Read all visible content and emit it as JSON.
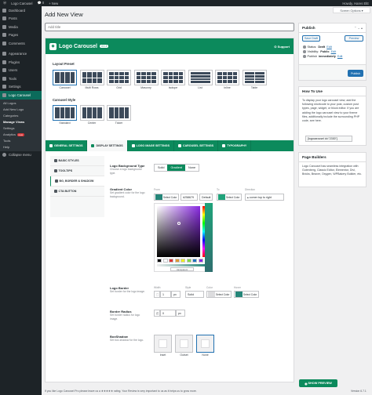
{
  "topbar": {
    "wp_logo": "wordpress-icon",
    "site_name": "Logo Carousel",
    "comments": "0",
    "new_label": "+ New",
    "howdy": "Howdy, Hares ElE"
  },
  "sidebar": {
    "items": [
      {
        "label": "Dashboard",
        "icon": "dashboard-icon"
      },
      {
        "label": "Posts",
        "icon": "pin-icon"
      },
      {
        "label": "Media",
        "icon": "media-icon"
      },
      {
        "label": "Pages",
        "icon": "page-icon"
      },
      {
        "label": "Comments",
        "icon": "comment-icon"
      },
      {
        "label": "Appearance",
        "icon": "brush-icon"
      },
      {
        "label": "Plugins",
        "icon": "plugin-icon"
      },
      {
        "label": "Users",
        "icon": "user-icon"
      },
      {
        "label": "Tools",
        "icon": "wrench-icon"
      },
      {
        "label": "Settings",
        "icon": "settings-icon"
      },
      {
        "label": "Logo Carousel",
        "icon": "carousel-icon"
      }
    ],
    "submenu": [
      "All Logos",
      "Add New Logo",
      "Categories",
      "Manage Views",
      "Settings",
      "Analytics",
      "Tools",
      "Help"
    ],
    "analytics_badge": "new",
    "collapse": "Collapse menu"
  },
  "screen_options": "Screen Options ▾",
  "heading": "Add New View",
  "title_placeholder": "Add title",
  "brand": {
    "name": "Logo Carousel",
    "version": "4.1.3",
    "support": "Support",
    "color": "#0c8a5c"
  },
  "layout_preset": {
    "label": "Layout Preset",
    "options": [
      "Carousel",
      "Multi Rows",
      "Grid",
      "Masonry",
      "Isotope",
      "List",
      "Inline",
      "Table"
    ],
    "selected": "Carousel"
  },
  "carousel_style": {
    "label": "Carousel Style",
    "options": [
      "Standard",
      "Center",
      "Ticker"
    ],
    "selected": "Standard"
  },
  "tabs": [
    "GENERAL SETTINGS",
    "DISPLAY SETTINGS",
    "LOGO IMAGE SETTINGS",
    "CAROUSEL SETTINGS",
    "TYPOGRAPHY"
  ],
  "active_tab": "DISPLAY SETTINGS",
  "subtabs": [
    "BASIC STYLES",
    "TOOLTIPS",
    "BG, BORDER & SHADOW",
    "CTA BUTTON"
  ],
  "active_subtab": "BG, BORDER & SHADOW",
  "bg_type": {
    "label": "Logo Background Type",
    "desc": "Choose a logo background type.",
    "options": [
      "Solid",
      "Gradient",
      "None"
    ],
    "selected": "Gradient"
  },
  "gradient": {
    "label": "Gradient Color",
    "desc": "Set gradient color for the logo background.",
    "from_label": "From",
    "to_label": "To",
    "direction_label": "Direction",
    "select_color": "Select Color",
    "from_hex": "#258679",
    "default_btn": "Default",
    "from_color": "#258679",
    "to_color": "#1fa37a",
    "direction": "▴ corner top to right",
    "picker_value": "transparent",
    "palette": [
      "#000000",
      "#ffffff",
      "#dd3333",
      "#dd9933",
      "#eeee22",
      "#81d742",
      "#1e73be",
      "#8224e3"
    ]
  },
  "border": {
    "label": "Logo Border",
    "desc": "Set border for the logo image.",
    "width_label": "Width",
    "style_label": "Style",
    "color_label": "Color",
    "hover_label": "Hover",
    "width": "1",
    "unit": "px",
    "style": "Solid",
    "select_color": "Select Color"
  },
  "radius": {
    "label": "Border Radius",
    "desc": "Set border radius for logo image.",
    "value": "0",
    "unit": "px"
  },
  "boxshadow": {
    "label": "BoxShadow",
    "desc": "Set box-shadow for the logo.",
    "options": [
      "Inset",
      "Outset",
      "None"
    ],
    "selected": "None"
  },
  "publish": {
    "title": "Publish",
    "save_draft": "Save Draft",
    "preview": "Preview",
    "status_label": "Status:",
    "status": "Draft",
    "visibility_label": "Visibility:",
    "visibility": "Public",
    "publish_label": "Publish",
    "publish_when": "immediately",
    "edit": "Edit",
    "publish_btn": "Publish"
  },
  "howto": {
    "title": "How To Use",
    "text": "To display your logo carousel view, add the following shortcode to your post, custom post types, page, widget, or block editor. If you are adding the logo carousel view to your theme files, additionally include the surrounding PHP code, see here.",
    "shortcode": "[logocarousel id=\"2330\"]"
  },
  "builders": {
    "title": "Page Builders",
    "text": "Logo Carousel has seamless integration with Gutenberg, Classic Editor, Elementor, Divi, Bricks, Beaver, Oxygen, WPBakery Builder, etc."
  },
  "show_preview": "SHOW PREVIEW",
  "footer": {
    "text": "If you like Logo Carousel Pro please leave us a ★★★★★ rating. Your Review is very important to us as it helps us to grow more.",
    "version": "Version 6.7.1"
  }
}
